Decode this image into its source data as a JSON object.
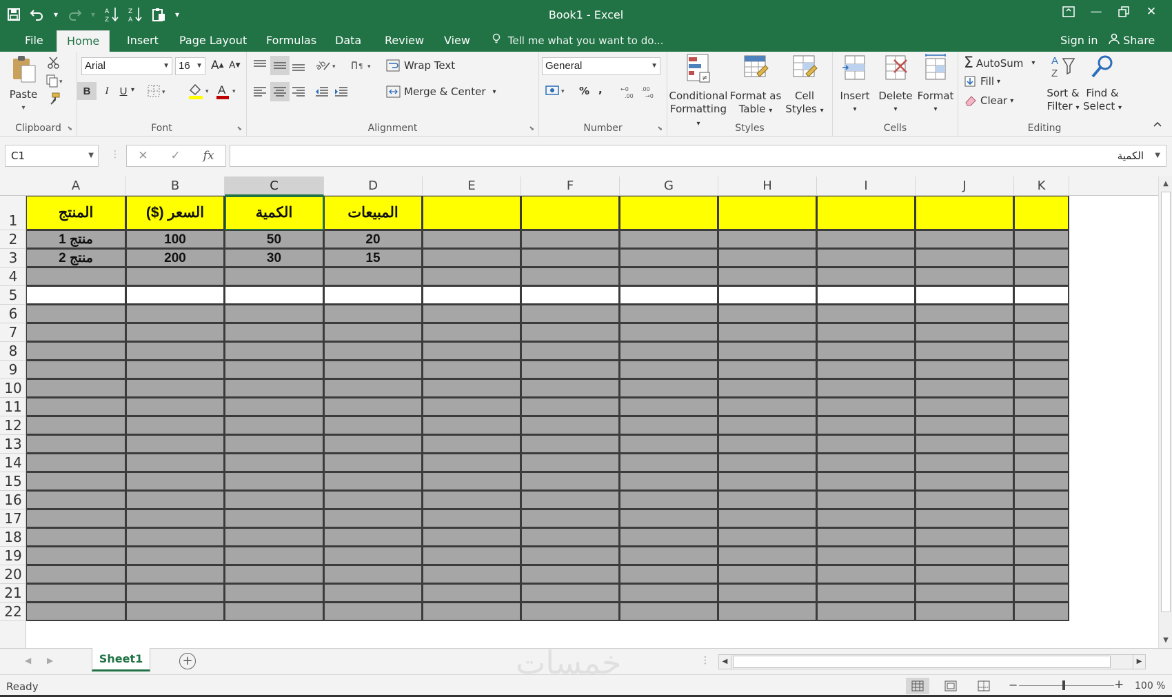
{
  "window": {
    "title": "Book1 - Excel",
    "controls": [
      "ribbon-display-icon",
      "minimize-icon",
      "restore-icon",
      "close-icon"
    ]
  },
  "quick_access": [
    "save-icon",
    "undo-icon",
    "redo-icon",
    "sort-ascending-icon",
    "sort-descending-icon",
    "paste-special-icon",
    "customize-qat-icon"
  ],
  "tabs": [
    {
      "label": "File"
    },
    {
      "label": "Home",
      "active": true
    },
    {
      "label": "Insert"
    },
    {
      "label": "Page Layout"
    },
    {
      "label": "Formulas"
    },
    {
      "label": "Data"
    },
    {
      "label": "Review"
    },
    {
      "label": "View"
    }
  ],
  "tell_me": "Tell me what you want to do...",
  "sign_in": "Sign in",
  "share": "Share",
  "ribbon": {
    "clipboard": {
      "label": "Clipboard",
      "paste": "Paste"
    },
    "font": {
      "label": "Font",
      "family": "Arial",
      "size": "16",
      "bold": "B",
      "italic": "I",
      "underline": "U"
    },
    "alignment": {
      "label": "Alignment",
      "wrap_text": "Wrap Text",
      "merge_center": "Merge & Center"
    },
    "number": {
      "label": "Number",
      "format": "General",
      "percent": "%",
      "comma": ","
    },
    "styles": {
      "label": "Styles",
      "conditional_1": "Conditional",
      "conditional_2": "Formatting",
      "format_table_1": "Format as",
      "format_table_2": "Table",
      "cell_styles_1": "Cell",
      "cell_styles_2": "Styles"
    },
    "cells": {
      "label": "Cells",
      "insert": "Insert",
      "delete": "Delete",
      "format": "Format"
    },
    "editing": {
      "label": "Editing",
      "autosum": "AutoSum",
      "fill": "Fill",
      "clear": "Clear",
      "sort_1": "Sort &",
      "sort_2": "Filter",
      "find_1": "Find &",
      "find_2": "Select"
    }
  },
  "formula_bar": {
    "name_box": "C1",
    "fx": "fx",
    "content": "الكمية"
  },
  "sheet": {
    "columns": [
      "A",
      "B",
      "C",
      "D",
      "E",
      "F",
      "G",
      "H",
      "I",
      "J",
      "K"
    ],
    "selected_column": "C",
    "rows": [
      "1",
      "2",
      "3",
      "4",
      "5",
      "6",
      "7",
      "8",
      "9",
      "10",
      "11",
      "12",
      "13",
      "14",
      "15",
      "16",
      "17",
      "18",
      "19",
      "20",
      "21",
      "22"
    ],
    "header_fill": "#ffff00",
    "data_fill": "#a6a6a6",
    "headers": [
      "المنتج",
      "السعر ($)",
      "الكمية",
      "المبيعات"
    ],
    "data": [
      [
        "منتج 1",
        "100",
        "50",
        "20"
      ],
      [
        "منتج 2",
        "200",
        "30",
        "15"
      ]
    ],
    "active_cell": "C1"
  },
  "sheet_tabs": {
    "active": "Sheet1"
  },
  "watermark": "خمسات",
  "status": {
    "ready": "Ready",
    "zoom": "100 %"
  },
  "accent": "#217346"
}
